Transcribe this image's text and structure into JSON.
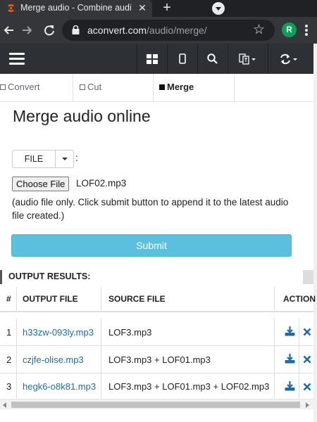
{
  "browser": {
    "tab_title": "Merge audio - Combine audio f",
    "tab_close": "✕",
    "new_tab": "+",
    "url_host": "aconvert.com",
    "url_path": "/audio/merge/",
    "avatar_letter": "R",
    "icons": [
      "favicon-icon",
      "close-icon",
      "plus-icon",
      "tab-search-icon",
      "back-icon",
      "forward-icon",
      "reload-icon",
      "lock-icon",
      "star-icon",
      "menu-dots-icon"
    ]
  },
  "site_nav": {
    "icons": [
      "hamburger-icon",
      "grid-icon",
      "mobile-icon",
      "search-icon",
      "language-icon",
      "sync-icon"
    ]
  },
  "tabs": [
    {
      "label": "Convert",
      "active": false
    },
    {
      "label": "Cut",
      "active": false
    },
    {
      "label": "Merge",
      "active": true
    }
  ],
  "main": {
    "title": "Merge audio online",
    "source_button": "FILE",
    "source_colon": ":",
    "choose_file_button": "Choose File",
    "chosen_file": "LOF02.mp3",
    "hint": "(audio file only. Click submit button to append it to the latest audio file created.)",
    "submit_label": "Submit"
  },
  "results": {
    "label": "OUTPUT RESULTS:",
    "columns": [
      "#",
      "OUTPUT FILE",
      "SOURCE FILE",
      "ACTION"
    ],
    "rows": [
      {
        "num": "1",
        "output": "h33zw-093ly.mp3",
        "source": "LOF3.mp3"
      },
      {
        "num": "2",
        "output": "czjfe-olise.mp3",
        "source": "LOF3.mp3 + LOF01.mp3"
      },
      {
        "num": "3",
        "output": "hegk6-o8k81.mp3",
        "source": "LOF3.mp3 + LOF01.mp3 + LOF02.mp3"
      }
    ]
  },
  "colors": {
    "chrome_dark": "#202124",
    "chrome_toolbar": "#35363a",
    "site_nav": "#2d3035",
    "submit": "#5bc0de",
    "link": "#1e6ba6",
    "action_icon": "#1e6ba6"
  }
}
